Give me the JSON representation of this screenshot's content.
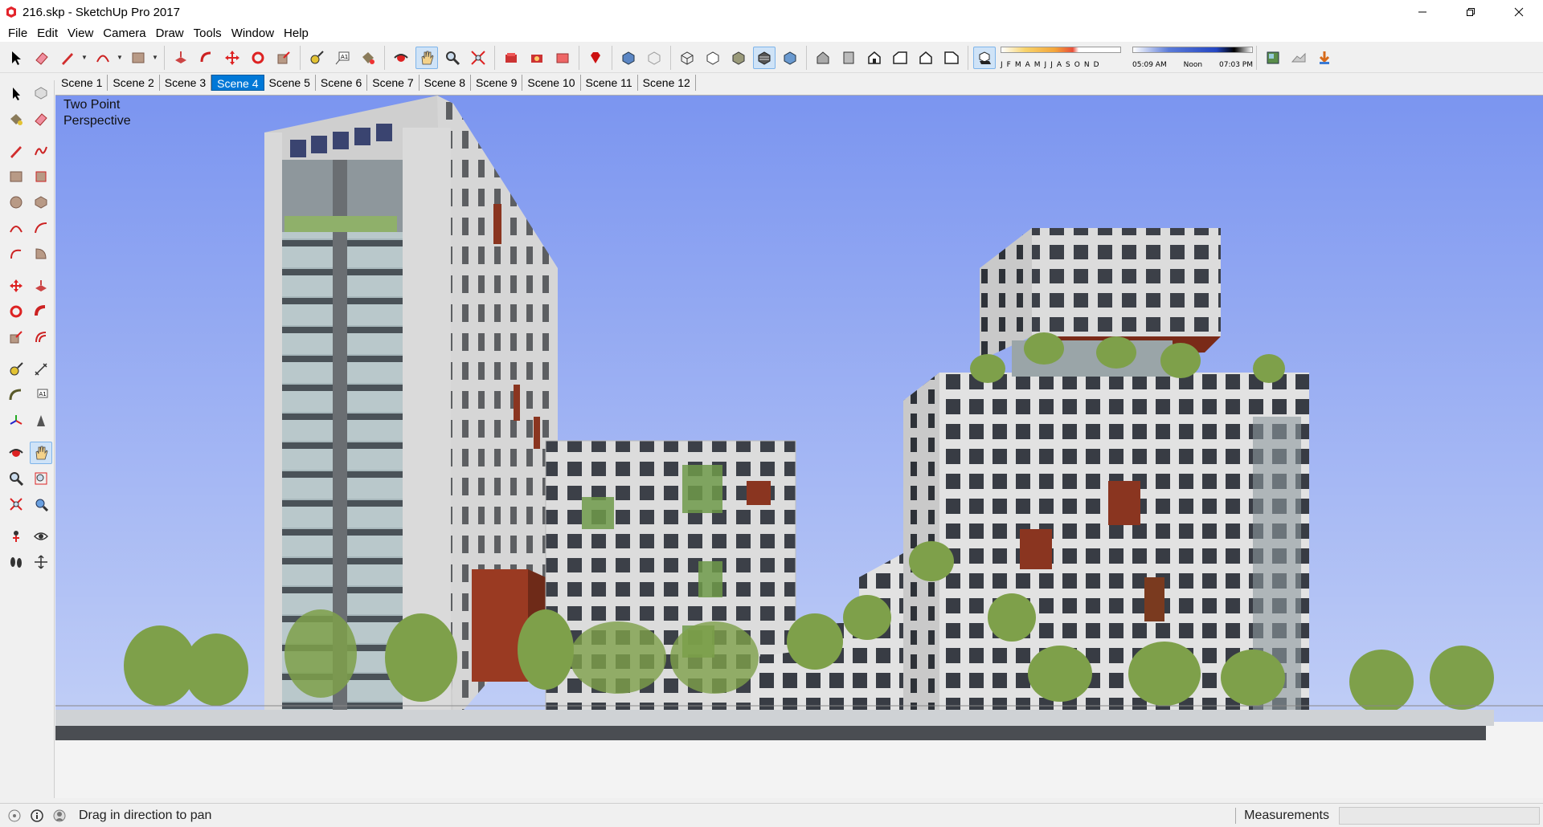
{
  "window": {
    "title": "216.skp - SketchUp Pro 2017"
  },
  "menu": {
    "items": [
      "File",
      "Edit",
      "View",
      "Camera",
      "Draw",
      "Tools",
      "Window",
      "Help"
    ]
  },
  "shadows": {
    "months": [
      "J",
      "F",
      "M",
      "A",
      "M",
      "J",
      "J",
      "A",
      "S",
      "O",
      "N",
      "D"
    ],
    "time_start": "05:09 AM",
    "time_mid": "Noon",
    "time_end": "07:03 PM"
  },
  "scenes": {
    "tabs": [
      "Scene 1",
      "Scene 2",
      "Scene 3",
      "Scene 4",
      "Scene 5",
      "Scene 6",
      "Scene 7",
      "Scene 8",
      "Scene 9",
      "Scene 10",
      "Scene 11",
      "Scene 12"
    ],
    "active": "Scene 4"
  },
  "viewport": {
    "camera_label_line1": "Two Point",
    "camera_label_line2": "Perspective"
  },
  "status": {
    "hint": "Drag in direction to pan",
    "measurements_label": "Measurements",
    "measurements_value": ""
  },
  "colors": {
    "sky_top": "#7b95f0",
    "sky_bottom": "#c9d5f7",
    "accent_selected": "#0078d7"
  }
}
